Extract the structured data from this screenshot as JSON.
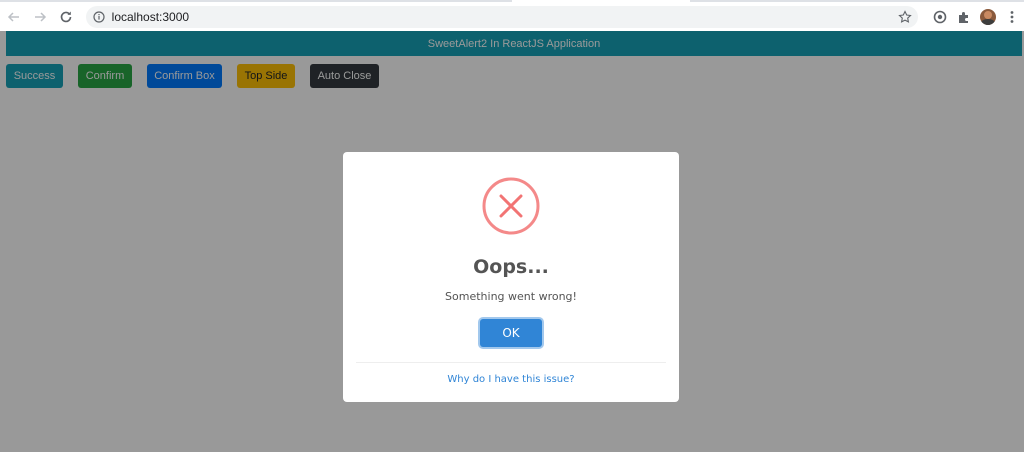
{
  "browser": {
    "url": "localhost:3000",
    "icons": {
      "back": "arrow-left-icon",
      "forward": "arrow-right-icon",
      "reload": "reload-icon",
      "site_info": "info-icon",
      "bookmark": "star-icon",
      "extension_1": "circle-extension-icon",
      "extensions": "puzzle-icon",
      "profile": "avatar",
      "menu": "kebab-menu-icon"
    }
  },
  "app": {
    "header_title": "SweetAlert2 In ReactJS Application",
    "buttons": {
      "success": "Success",
      "confirm": "Confirm",
      "confirm_box": "Confirm Box",
      "top_side": "Top Side",
      "auto_close": "Auto Close"
    },
    "colors": {
      "header": "#17a2b8",
      "success": "#17a2b8",
      "confirm": "#28a745",
      "confirm_box": "#007bff",
      "top_side": "#ffc107",
      "auto_close": "#343a40"
    }
  },
  "modal": {
    "icon": "error-x-icon",
    "icon_color": "#f27474",
    "title": "Oops...",
    "text": "Something went wrong!",
    "ok_label": "OK",
    "footer_link": "Why do I have this issue?",
    "ok_color": "#3085d6"
  }
}
